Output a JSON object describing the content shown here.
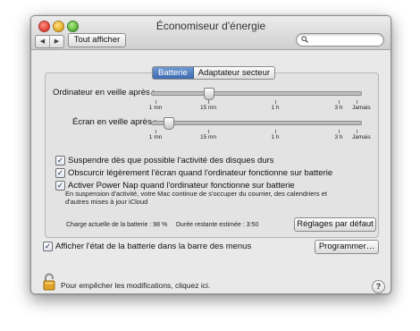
{
  "window": {
    "title": "Économiseur d'énergie"
  },
  "toolbar": {
    "back_glyph": "◀",
    "forward_glyph": "▶",
    "show_all_label": "Tout afficher",
    "search_placeholder": ""
  },
  "tabs": [
    {
      "label": "Batterie",
      "active": true
    },
    {
      "label": "Adaptateur secteur",
      "active": false
    }
  ],
  "sliders": [
    {
      "label": "Ordinateur en veille après :",
      "value_label": "15 mn",
      "ticks": [
        "1 mn",
        "15 mn",
        "1 h",
        "3 h",
        "Jamais"
      ]
    },
    {
      "label": "Écran en veille après :",
      "value_label": "2 mn",
      "ticks": [
        "1 mn",
        "15 mn",
        "1 h",
        "3 h",
        "Jamais"
      ]
    }
  ],
  "options": [
    {
      "label": "Suspendre dès que possible l'activité des disques durs",
      "checked": true
    },
    {
      "label": "Obscurcir légèrement l'écran quand l'ordinateur fonctionne sur batterie",
      "checked": true
    },
    {
      "label": "Activer Power Nap quand l'ordinateur fonctionne sur batterie",
      "checked": true
    }
  ],
  "power_nap_description": "En suspension d'activité, votre Mac continue de s'occuper du courrier, des calendriers et d'autres mises à jour iCloud",
  "battery_status": {
    "charge": "Charge actuelle de la batterie : 98 %",
    "remaining": "Durée restante estimée : 3:50"
  },
  "buttons": {
    "defaults": "Réglages par défaut",
    "schedule": "Programmer…"
  },
  "menu_bar_option": {
    "label": "Afficher l'état de la batterie dans la barre des menus",
    "checked": true
  },
  "lock": {
    "text": "Pour empêcher les modifications, cliquez ici."
  },
  "help": {
    "glyph": "?"
  },
  "check_glyph": "✓",
  "colors": {
    "accent": "#3c69b1",
    "window_bg": "#e9e9e9"
  }
}
